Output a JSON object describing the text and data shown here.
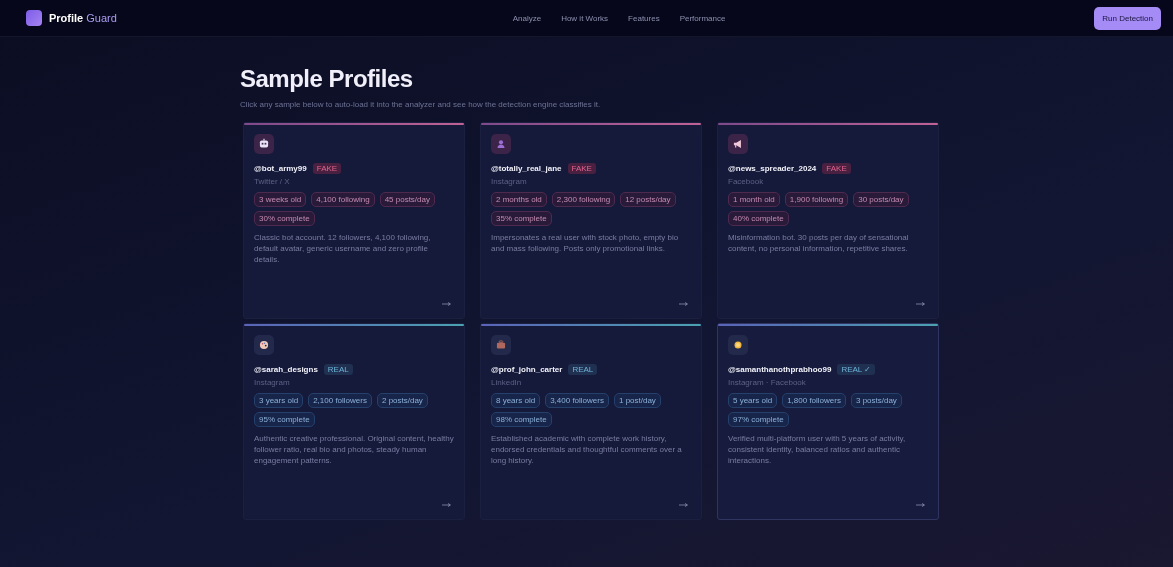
{
  "header": {
    "logo": "Profile",
    "logo_accent": "Guard",
    "nav": [
      {
        "label": "Analyze"
      },
      {
        "label": "How it Works"
      },
      {
        "label": "Features"
      },
      {
        "label": "Performance"
      }
    ],
    "action": "Run Detection"
  },
  "section": {
    "title": "Sample Profiles",
    "subtitle": "Click any sample below to auto-load it into the analyzer and see how the detection engine classifies it."
  },
  "profiles": [
    {
      "kind": "fake",
      "handle": "@bot_army99",
      "badge": "FAKE",
      "platform": "Twitter / X",
      "tags": [
        "3 weeks old",
        "4,100 following",
        "45 posts/day",
        "30% complete"
      ],
      "bio": "Classic bot account. 12 followers, 4,100 following, default avatar, generic username and zero profile details.",
      "hovered": false
    },
    {
      "kind": "fake",
      "handle": "@totally_real_jane",
      "badge": "FAKE",
      "platform": "Instagram",
      "tags": [
        "2 months old",
        "2,300 following",
        "12 posts/day",
        "35% complete"
      ],
      "bio": "Impersonates a real user with stock photo, empty bio and mass following. Posts only promotional links.",
      "hovered": false
    },
    {
      "kind": "fake",
      "handle": "@news_spreader_2024",
      "badge": "FAKE",
      "platform": "Facebook",
      "tags": [
        "1 month old",
        "1,900 following",
        "30 posts/day",
        "40% complete"
      ],
      "bio": "Misinformation bot. 30 posts per day of sensational content, no personal information, repetitive shares.",
      "hovered": false
    },
    {
      "kind": "real",
      "handle": "@sarah_designs",
      "badge": "REAL",
      "platform": "Instagram",
      "tags": [
        "3 years old",
        "2,100 followers",
        "2 posts/day",
        "95% complete"
      ],
      "bio": "Authentic creative professional. Original content, healthy follower ratio, real bio and photos, steady human engagement patterns.",
      "hovered": false
    },
    {
      "kind": "real",
      "handle": "@prof_john_carter",
      "badge": "REAL",
      "platform": "LinkedIn",
      "tags": [
        "8 years old",
        "3,400 followers",
        "1 post/day",
        "98% complete"
      ],
      "bio": "Established academic with complete work history, endorsed credentials and thoughtful comments over a long history.",
      "hovered": false
    },
    {
      "kind": "real",
      "handle": "@samanthanothprabhoo99",
      "badge": "REAL ✓",
      "platform": "Instagram · Facebook",
      "tags": [
        "5 years old",
        "1,800 followers",
        "3 posts/day",
        "97% complete"
      ],
      "bio": "Verified multi-platform user with 5 years of activity, consistent identity, balanced ratios and authentic interactions.",
      "hovered": true
    }
  ]
}
